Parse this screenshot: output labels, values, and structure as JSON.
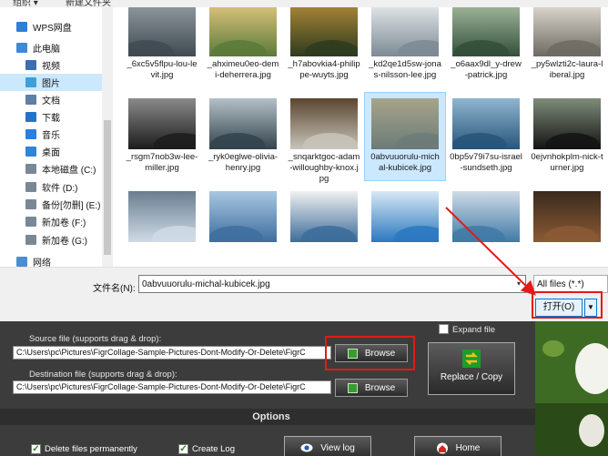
{
  "dialog": {
    "toolbar": {
      "organize": "组织 ▾",
      "new_folder": "新建文件夹"
    },
    "nav": {
      "items": [
        {
          "label": "WPS网盘",
          "icon": "cloud-icon"
        },
        {
          "label": "此电脑",
          "icon": "computer-icon"
        },
        {
          "label": "视频",
          "icon": "video-folder-icon"
        },
        {
          "label": "图片",
          "icon": "pictures-folder-icon",
          "selected": true
        },
        {
          "label": "文档",
          "icon": "documents-folder-icon"
        },
        {
          "label": "下载",
          "icon": "download-icon"
        },
        {
          "label": "音乐",
          "icon": "music-icon"
        },
        {
          "label": "桌面",
          "icon": "desktop-folder-icon"
        },
        {
          "label": "本地磁盘 (C:)",
          "icon": "drive-icon"
        },
        {
          "label": "软件 (D:)",
          "icon": "drive-icon"
        },
        {
          "label": "备份[勿删] (E:)",
          "icon": "drive-icon"
        },
        {
          "label": "新加卷 (F:)",
          "icon": "drive-icon"
        },
        {
          "label": "新加卷 (G:)",
          "icon": "drive-icon"
        },
        {
          "label": "网络",
          "icon": "network-icon"
        }
      ]
    },
    "files": [
      {
        "name": "_6xc5v5flpu-lou-levit.jpg",
        "colors": [
          "#3f4a52",
          "#8e979c"
        ]
      },
      {
        "name": "_ahximeu0eo-demi-deherrera.jpg",
        "colors": [
          "#5b7a3a",
          "#d8c27a"
        ]
      },
      {
        "name": "_h7abovkia4-philippe-wuyts.jpg",
        "colors": [
          "#2e3b1e",
          "#a68436"
        ]
      },
      {
        "name": "_kd2qe1d5sw-jonas-nilsson-lee.jpg",
        "colors": [
          "#7c8a94",
          "#e1e5e7"
        ]
      },
      {
        "name": "_o6aax9dl_y-drew-patrick.jpg",
        "colors": [
          "#334f3a",
          "#9fb59a"
        ]
      },
      {
        "name": "_py5wlzti2c-laura-liberal.jpg",
        "colors": [
          "#6d6a64",
          "#dcd7cc"
        ]
      },
      {
        "name": "_rsgm7nob3w-lee-miller.jpg",
        "colors": [
          "#1c1c1c",
          "#8a8a8a"
        ]
      },
      {
        "name": "_ryk0eglwe-olivia-henry.jpg",
        "colors": [
          "#33434c",
          "#b3c0c7"
        ]
      },
      {
        "name": "_snqarktgoc-adam-willoughby-knox.jpg",
        "colors": [
          "#c8c4ba",
          "#5a4630"
        ]
      },
      {
        "name": "0abvuuorulu-michal-kubicek.jpg",
        "colors": [
          "#6c7b78",
          "#a6a48a"
        ],
        "selected": true
      },
      {
        "name": "0bp5v79i7su-israel-sundseth.jpg",
        "colors": [
          "#27557a",
          "#8fb6d0"
        ]
      },
      {
        "name": "0ejvnhokplm-nick-turner.jpg",
        "colors": [
          "#131313",
          "#7f8c7a"
        ]
      },
      {
        "name": "",
        "colors": [
          "#cfdbe6",
          "#6a7e90"
        ]
      },
      {
        "name": "",
        "colors": [
          "#3e6e9e",
          "#a8c7e2"
        ]
      },
      {
        "name": "",
        "colors": [
          "#3c6c9a",
          "#f0f0f0"
        ]
      },
      {
        "name": "",
        "colors": [
          "#2a78c0",
          "#d8e8f4"
        ]
      },
      {
        "name": "",
        "colors": [
          "#3f7aa6",
          "#cfdbe6"
        ]
      },
      {
        "name": "",
        "colors": [
          "#8a5a35",
          "#3a2a1c"
        ]
      }
    ],
    "filename_label": "文件名(N):",
    "filename_value": "0abvuuorulu-michal-kubicek.jpg",
    "filter_value": "All files (*.*)",
    "open_label": "打开(O)",
    "open_drop": "▼",
    "focus_color": "#e21a1a"
  },
  "app": {
    "expand_label": "Expand file",
    "source_label": "Source file (supports drag & drop):",
    "source_path": "C:\\Users\\pc\\Pictures\\FigrCollage-Sample-Pictures-Dont-Modify-Or-Delete\\FigrC",
    "browse_label": "Browse",
    "dest_label": "Destination file (supports drag & drop):",
    "dest_path": "C:\\Users\\pc\\Pictures\\FigrCollage-Sample-Pictures-Dont-Modify-Or-Delete\\FigrC",
    "replace_label": "Replace / Copy",
    "options_title": "Options",
    "delete_label": "Delete files permanently",
    "create_log_label": "Create Log",
    "view_log_label": "View log",
    "home_label": "Home",
    "check_mark": "✓"
  }
}
